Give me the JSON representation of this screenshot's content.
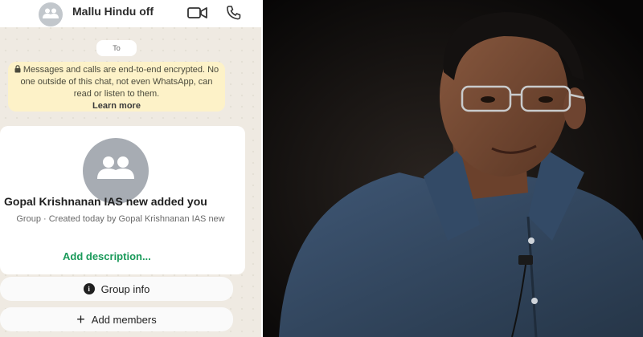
{
  "chat": {
    "title": "Mallu Hindu off",
    "date_chip": "To",
    "encryption_notice": "Messages and calls are end-to-end encrypted. No one outside of this chat, not even WhatsApp, can read or listen to them.",
    "learn_more": "Learn more",
    "card": {
      "title": "Gopal Krishnanan IAS new added you",
      "subtitle": "Group · Created today by Gopal Krishnanan IAS new",
      "add_description": "Add description..."
    },
    "buttons": {
      "group_info": "Group info",
      "add_members": "Add members"
    }
  },
  "icons": [
    "group-avatar-icon",
    "video-call-icon",
    "phone-icon",
    "lock-icon",
    "info-icon",
    "plus-icon"
  ],
  "colors": {
    "accent_green": "#1a9a5a",
    "notice_bg": "#fdf2c8",
    "chat_bg": "#efeae2"
  }
}
